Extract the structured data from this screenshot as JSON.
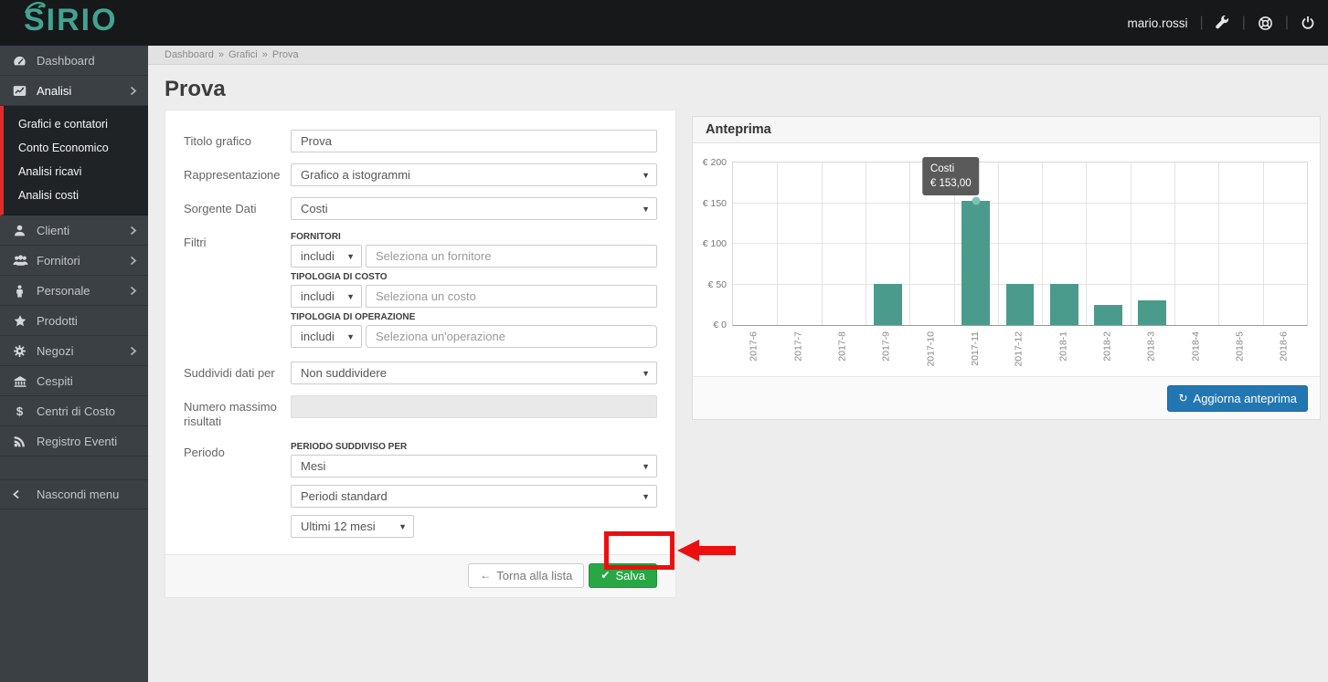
{
  "navbar": {
    "logo": "SIRIO",
    "username": "mario.rossi",
    "icons": [
      "wrench-icon",
      "support-icon",
      "power-icon"
    ]
  },
  "sidebar": {
    "items": [
      {
        "label": "Dashboard",
        "icon": "gauge",
        "expandable": false,
        "active": false
      },
      {
        "label": "Analisi",
        "icon": "chart",
        "expandable": true,
        "active": true
      },
      {
        "label": "Clienti",
        "icon": "user",
        "expandable": true,
        "active": false
      },
      {
        "label": "Fornitori",
        "icon": "users",
        "expandable": true,
        "active": false
      },
      {
        "label": "Personale",
        "icon": "person",
        "expandable": true,
        "active": false
      },
      {
        "label": "Prodotti",
        "icon": "star",
        "expandable": false,
        "active": false
      },
      {
        "label": "Negozi",
        "icon": "gear",
        "expandable": true,
        "active": false
      },
      {
        "label": "Cespiti",
        "icon": "bank",
        "expandable": false,
        "active": false
      },
      {
        "label": "Centri di Costo",
        "icon": "dollar",
        "expandable": false,
        "active": false
      },
      {
        "label": "Registro Eventi",
        "icon": "rss",
        "expandable": false,
        "active": false
      }
    ],
    "submenu_after_index": 1,
    "submenu_items": [
      "Grafici e contatori",
      "Conto Economico",
      "Analisi ricavi",
      "Analisi costi"
    ],
    "hide_menu_label": "Nascondi menu"
  },
  "breadcrumb": {
    "items": [
      "Dashboard",
      "Grafici",
      "Prova"
    ],
    "separator": "»"
  },
  "page": {
    "title": "Prova"
  },
  "form": {
    "titolo_grafico": {
      "label": "Titolo grafico",
      "value": "Prova"
    },
    "rappresentazione": {
      "label": "Rappresentazione",
      "value": "Grafico a istogrammi"
    },
    "sorgente_dati": {
      "label": "Sorgente Dati",
      "value": "Costi"
    },
    "filtri": {
      "label": "Filtri",
      "rows": [
        {
          "group_label": "FORNITORI",
          "mode": "includi",
          "placeholder": "Seleziona un fornitore",
          "rounded": false
        },
        {
          "group_label": "TIPOLOGIA DI COSTO",
          "mode": "includi",
          "placeholder": "Seleziona un costo",
          "rounded": false
        },
        {
          "group_label": "TIPOLOGIA DI OPERAZIONE",
          "mode": "includi",
          "placeholder": "Seleziona un'operazione",
          "rounded": true
        }
      ]
    },
    "suddividi": {
      "label": "Suddividi dati per",
      "value": "Non suddividere"
    },
    "numero_massimo": {
      "label": "Numero massimo risultati",
      "value": "",
      "disabled": true
    },
    "periodo": {
      "label": "Periodo",
      "group_label": "PERIODO SUDDIVISO PER",
      "select1": "Mesi",
      "select2": "Periodi standard",
      "select3": "Ultimi 12 mesi"
    },
    "buttons": {
      "back": "Torna alla lista",
      "save": "Salva"
    }
  },
  "preview": {
    "title": "Anteprima",
    "refresh_button": "Aggiorna anteprima"
  },
  "chart_data": {
    "type": "bar",
    "title": "Anteprima",
    "series_name": "Costi",
    "categories": [
      "2017-6",
      "2017-7",
      "2017-8",
      "2017-9",
      "2017-10",
      "2017-11",
      "2017-12",
      "2018-1",
      "2018-2",
      "2018-3",
      "2018-4",
      "2018-5",
      "2018-6"
    ],
    "values": [
      0,
      0,
      0,
      51,
      0,
      153,
      51,
      51,
      25,
      30,
      0,
      0,
      0
    ],
    "ylim": [
      0,
      200
    ],
    "yticks": [
      0,
      50,
      100,
      150,
      200
    ],
    "ytick_prefix": "€ ",
    "xlabel": "",
    "ylabel": "",
    "grid": true,
    "legend": "none",
    "bar_color": "#4a9b8c",
    "tooltip": {
      "index": 5,
      "title": "Costi",
      "value": "€ 153,00"
    }
  },
  "colors": {
    "accent_teal": "#41a391",
    "save_green": "#28a745",
    "refresh_blue": "#2277b2",
    "annotation_red": "#ec0f0f",
    "submenu_accent_red": "#e02b2b",
    "bar_teal": "#4a9b8c"
  }
}
